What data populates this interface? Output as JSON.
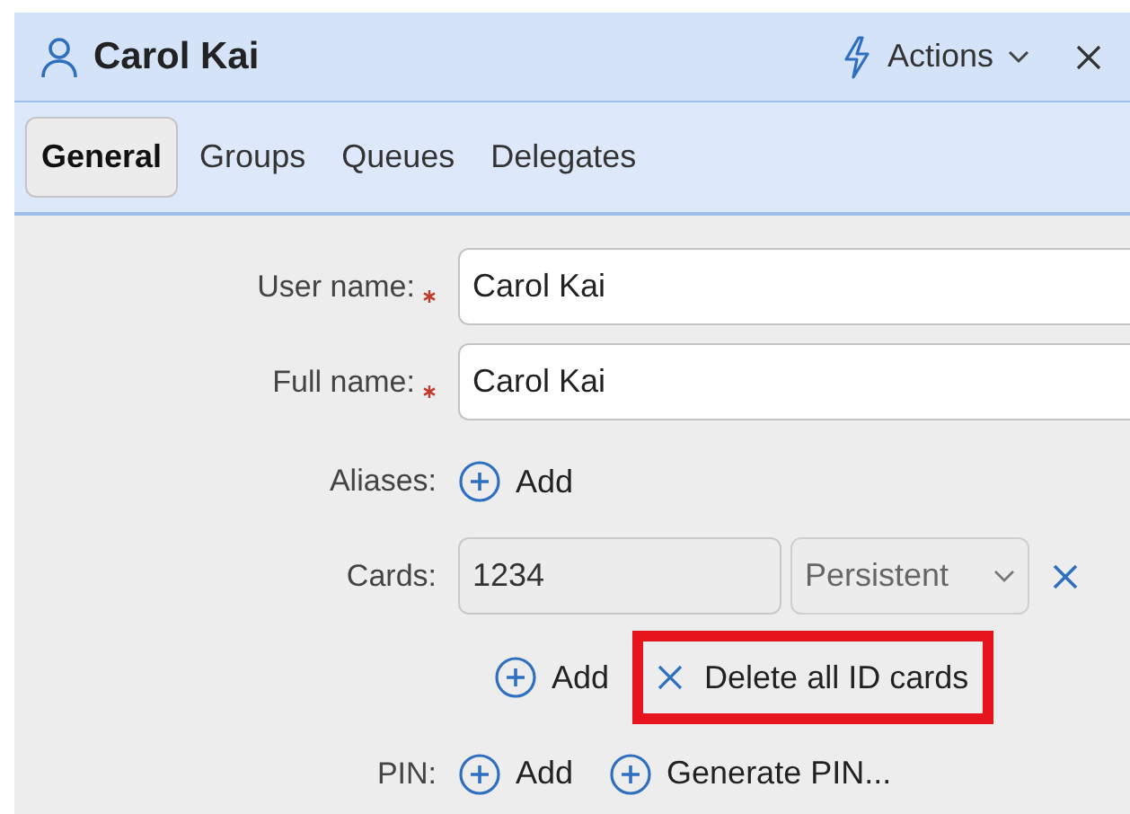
{
  "header": {
    "title": "Carol Kai",
    "actions_label": "Actions"
  },
  "tabs": [
    {
      "label": "General",
      "selected": true
    },
    {
      "label": "Groups",
      "selected": false
    },
    {
      "label": "Queues",
      "selected": false
    },
    {
      "label": "Delegates",
      "selected": false
    }
  ],
  "form": {
    "user_name": {
      "label": "User name:",
      "required": true,
      "value": "Carol Kai"
    },
    "full_name": {
      "label": "Full name:",
      "required": true,
      "value": "Carol Kai"
    },
    "aliases": {
      "label": "Aliases:",
      "add_label": "Add"
    },
    "cards": {
      "label": "Cards:",
      "value": "1234",
      "type": "Persistent",
      "add_label": "Add",
      "delete_all_label": "Delete all ID cards",
      "delete_all_highlighted": true
    },
    "pin": {
      "label": "PIN:",
      "add_label": "Add",
      "generate_label": "Generate PIN..."
    }
  }
}
